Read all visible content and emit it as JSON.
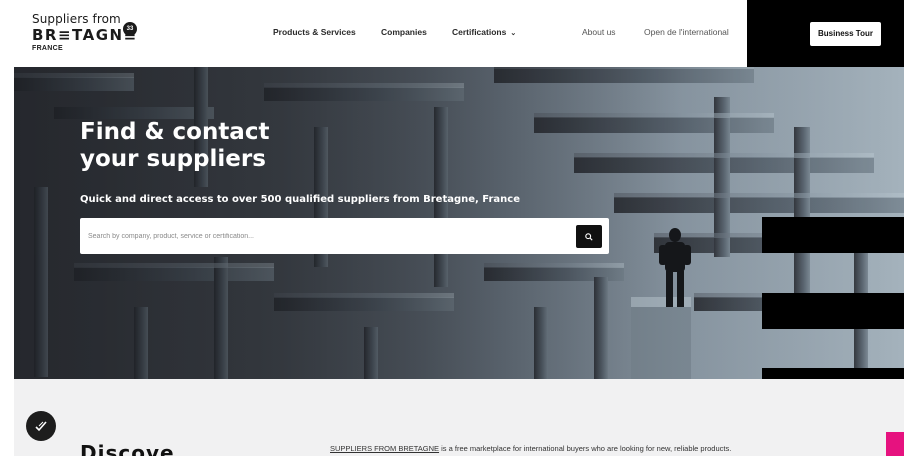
{
  "header": {
    "logo": {
      "line1": "Suppliers from",
      "line2": "BR≡TAGN≡",
      "line3": "FRANCE",
      "badge": "33"
    },
    "nav": {
      "products": "Products & Services",
      "companies": "Companies",
      "certifications": "Certifications",
      "about": "About us",
      "international": "Open de l'international"
    },
    "cta": "Business Tour"
  },
  "hero": {
    "title_line1": "Find & contact",
    "title_line2": "your suppliers",
    "subtitle": "Quick and direct access to over 500 qualified suppliers from Bretagne, France",
    "search": {
      "placeholder": "Search by company, product, service or certification..."
    }
  },
  "section": {
    "heading": "Discove",
    "tagline_brand": "SUPPLIERS FROM BRETAGNE",
    "tagline_rest": " is a free marketplace for international buyers who are looking for new, reliable products."
  },
  "colors": {
    "accent_pink": "#e6127f",
    "header_black": "#000000",
    "button_dark": "#111111"
  },
  "icons": [
    "search-icon",
    "chevron-down-icon",
    "leaf-check-icon"
  ]
}
